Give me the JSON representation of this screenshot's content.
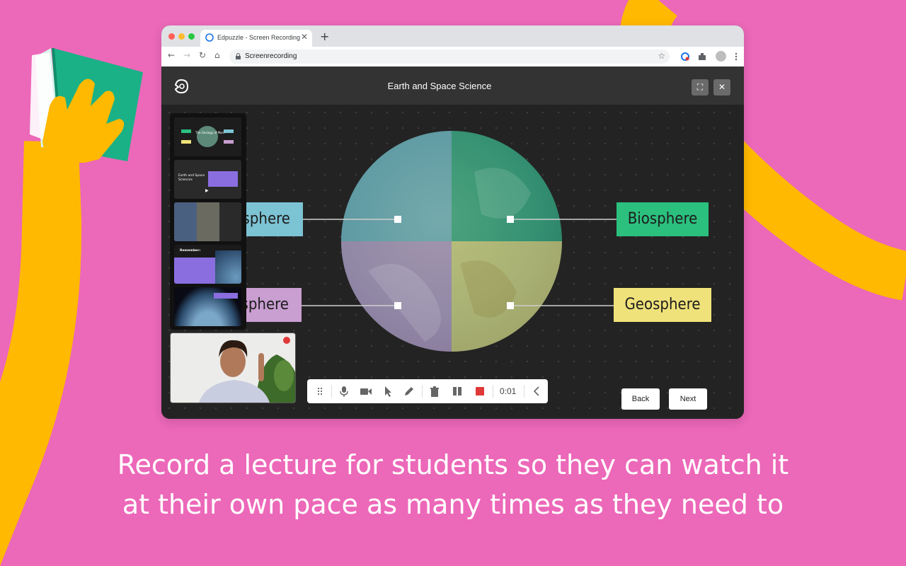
{
  "colors": {
    "background": "#ec68b9",
    "yellow": "#ffb900",
    "green": "#1ab187",
    "hydro_blue": "#7cc3d4",
    "bio_green": "#2bc07e",
    "atmo_purple": "#c99ed1",
    "geo_yellow": "#f0e27b",
    "record_red": "#e03838"
  },
  "browser": {
    "tab_title": "Edpuzzle - Screen Recording",
    "tab_close": "✕",
    "new_tab": "+",
    "address": "Screenrecording",
    "back_icon": "←",
    "forward_icon": "→",
    "reload_icon": "↻",
    "home_icon": "⌂",
    "star_icon": "☆"
  },
  "app": {
    "title": "Earth and Space Science",
    "fullscreen_icon": "⛶",
    "close_icon": "✕"
  },
  "slide": {
    "labels": {
      "top_left": "sphere",
      "top_right": "Biosphere",
      "bottom_left": "sphere",
      "bottom_right": "Geosphere"
    }
  },
  "thumbnails": [
    {
      "title": "The Geology of Mars"
    },
    {
      "title": "Earth and Space Sciences"
    },
    {
      "title": ""
    },
    {
      "title": "Remember:"
    },
    {
      "title": ""
    }
  ],
  "toolbar": {
    "timer": "0:01"
  },
  "buttons": {
    "back": "Back",
    "next": "Next"
  },
  "caption": {
    "line1": "Record a lecture for students so they can watch it",
    "line2": "at their own pace as many times as they need to"
  }
}
